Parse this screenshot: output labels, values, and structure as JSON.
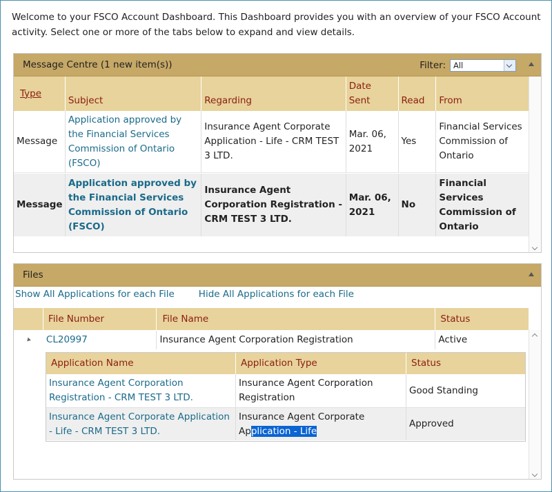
{
  "intro": "Welcome to your FSCO Account Dashboard. This Dashboard provides you with an overview of your FSCO Account activity. Select one or more of the tabs below to expand and view details.",
  "messages": {
    "header": "Message Centre (1 new item(s))",
    "filter_label": "Filter:",
    "filter_value": "All",
    "columns": [
      "Type",
      "Subject",
      "Regarding",
      "Date Sent",
      "Read",
      "From"
    ],
    "col_date_line1": "Date",
    "col_date_line2": "Sent",
    "rows": [
      {
        "type": "Message",
        "subject": "Application approved by the Financial Services Commission of Ontario (FSCO)",
        "regarding": "Insurance Agent Corporate Application - Life - CRM TEST 3 LTD.",
        "date": "Mar. 06, 2021",
        "read": "Yes",
        "from": "Financial Services Commission of Ontario"
      },
      {
        "type": "Message",
        "subject": "Application approved by the Financial Services Commission of Ontario (FSCO)",
        "regarding": "Insurance Agent Corporation Registration - CRM TEST 3 LTD.",
        "date": "Mar. 06, 2021",
        "read": "No",
        "from": "Financial Services Commission of Ontario"
      }
    ]
  },
  "files": {
    "header": "Files",
    "show_all": "Show All Applications for each File",
    "hide_all": "Hide All Applications for each File",
    "columns": [
      "File Number",
      "File Name",
      "Status"
    ],
    "file": {
      "number": "CL20997",
      "name": "Insurance Agent Corporation Registration",
      "status": "Active"
    },
    "app_columns": [
      "Application Name",
      "Application Type",
      "Status"
    ],
    "apps": [
      {
        "name": "Insurance Agent Corporation Registration - CRM TEST 3 LTD.",
        "type": "Insurance Agent Corporation Registration",
        "status": "Good Standing"
      },
      {
        "name": "Insurance Agent Corporate Application - Life - CRM TEST 3 LTD.",
        "type_prefix": "Insurance Agent Corporate Ap",
        "type_selected": "plication - Life",
        "status": "Approved"
      }
    ]
  }
}
